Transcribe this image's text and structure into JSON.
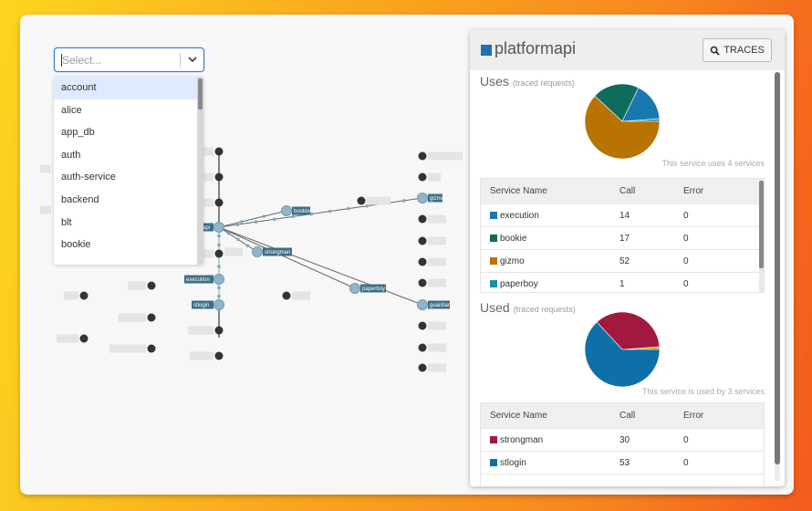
{
  "select": {
    "placeholder": "Select...",
    "options": [
      "account",
      "alice",
      "app_db",
      "auth",
      "auth-service",
      "backend",
      "blt",
      "bookie"
    ],
    "highlighted": "account"
  },
  "graph": {
    "labeled_nodes": [
      "api",
      "bookie",
      "gizmo",
      "strongman",
      "execution",
      "stlogin",
      "paperboy",
      "guardian"
    ]
  },
  "panel": {
    "service_name": "platformapi",
    "service_color": "#1f6fb2",
    "traces_label": "TRACES",
    "uses": {
      "title": "Uses",
      "subtitle": "(traced requests)",
      "caption": "This service uses 4 services",
      "headers": [
        "Service Name",
        "Call",
        "Error"
      ],
      "rows": [
        {
          "name": "execution",
          "call": "14",
          "error": "0",
          "color": "#1a78b0"
        },
        {
          "name": "bookie",
          "call": "17",
          "error": "0",
          "color": "#0f6b5c"
        },
        {
          "name": "gizmo",
          "call": "52",
          "error": "0",
          "color": "#b87300"
        },
        {
          "name": "paperboy",
          "call": "1",
          "error": "0",
          "color": "#1b8fa8"
        }
      ]
    },
    "used": {
      "title": "Used",
      "subtitle": "(traced requests)",
      "caption": "This service is used by 3 services",
      "headers": [
        "Service Name",
        "Call",
        "Error"
      ],
      "rows": [
        {
          "name": "strongman",
          "call": "30",
          "error": "0",
          "color": "#a3183f"
        },
        {
          "name": "stlogin",
          "call": "53",
          "error": "0",
          "color": "#0e70a8"
        }
      ]
    }
  },
  "chart_data": [
    {
      "type": "pie",
      "title": "Uses (traced requests)",
      "labels": [
        "paperboy",
        "execution",
        "bookie",
        "gizmo"
      ],
      "values": [
        1,
        14,
        17,
        52
      ],
      "colors": [
        "#1b8fa8",
        "#1a78b0",
        "#0f6b5c",
        "#b87300"
      ]
    },
    {
      "type": "pie",
      "title": "Used (traced requests)",
      "labels": [
        "",
        "strongman",
        "stlogin"
      ],
      "values": [
        1,
        30,
        53
      ],
      "colors": [
        "#c9a300",
        "#a3183f",
        "#0e70a8"
      ]
    }
  ]
}
